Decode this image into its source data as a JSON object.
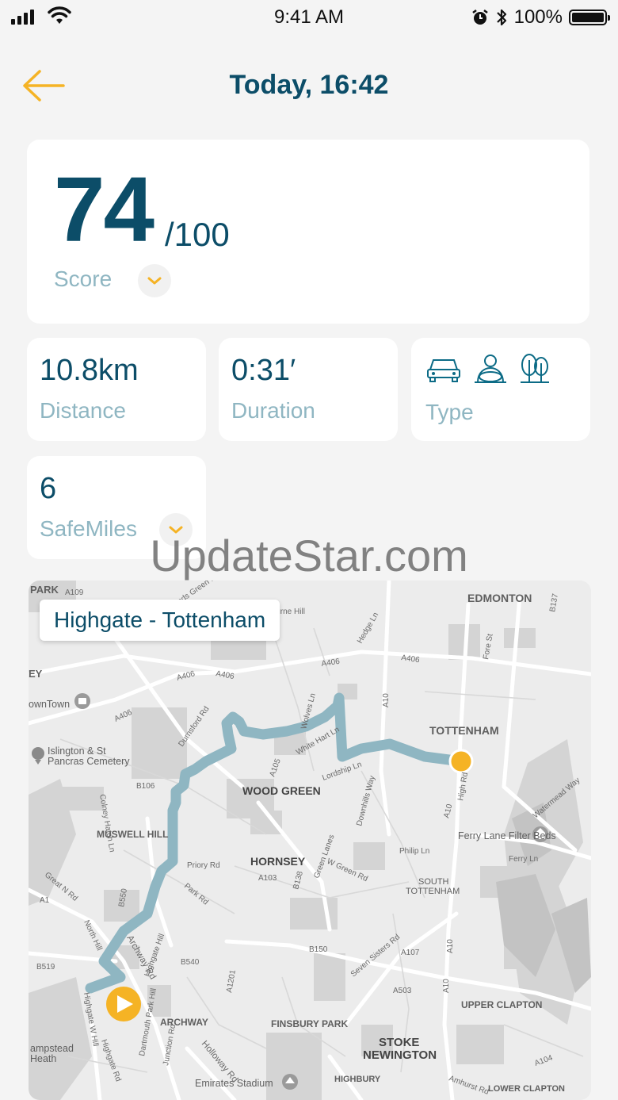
{
  "status_bar": {
    "time": "9:41 AM",
    "battery": "100%"
  },
  "header": {
    "title": "Today, 16:42"
  },
  "score": {
    "value": "74",
    "max": "/100",
    "label": "Score"
  },
  "stats": {
    "distance": {
      "value": "10.8km",
      "label": "Distance"
    },
    "duration": {
      "value": "0:31′",
      "label": "Duration"
    },
    "type": {
      "label": "Type",
      "icons": [
        "car-icon",
        "driver-icon",
        "trees-icon"
      ]
    },
    "safemiles": {
      "value": "6",
      "label": "SafeMiles"
    }
  },
  "watermark": "UpdateStar.com",
  "map": {
    "route_label": "Highgate - Tottenham",
    "labels": {
      "park": "PARK",
      "edmonton": "EDMONTON",
      "tottenham": "TOTTENHAM",
      "ey": "EY",
      "owntown": "ownTown",
      "islington": "Islington & St",
      "pancras": "Pancras Cemetery",
      "wood_green": "WOOD GREEN",
      "muswell_hill": "MUSWELL HILL",
      "hornsey": "HORNSEY",
      "ferry_lane": "Ferry Lane Filter Beds",
      "south": "SOUTH",
      "south_tottenham": "TOTTENHAM",
      "archway": "ARCHWAY",
      "finsbury_park": "FINSBURY PARK",
      "upper_clapton": "UPPER CLAPTON",
      "stoke": "STOKE",
      "newington": "NEWINGTON",
      "ampstead": "ampstead",
      "heath": "Heath",
      "emirates": "Emirates Stadium",
      "highbury": "HIGHBURY",
      "lower_clapton": "LOWER CLAPTON"
    },
    "roads": {
      "a406_1": "A406",
      "a406_2": "A406",
      "a406_3": "A406",
      "a406_4": "A406",
      "a406_5": "A406",
      "a10_1": "A10",
      "a10_2": "A10",
      "a10_3": "A10",
      "a10_4": "A10",
      "a1": "A1",
      "a107": "A107",
      "a103": "A103",
      "a105": "A105",
      "a104": "A104",
      "a503": "A503",
      "a1201": "A1201",
      "b150": "B150",
      "b540": "B540",
      "b550": "B550",
      "b519": "B519",
      "b106": "B106",
      "b138": "B138",
      "b137": "B137",
      "a109": "A109",
      "archway_rd": "Archway Rd",
      "holloway_rd": "Holloway Rd",
      "seven_sisters": "Seven Sisters Rd",
      "green_lanes": "Green Lanes",
      "high_rd": "High Rd",
      "fore_st": "Fore St",
      "hedge_ln": "Hedge Ln",
      "white_hart": "White Hart Ln",
      "lordship": "Lordship Ln",
      "priory": "Priory Rd",
      "park_rd": "Park Rd",
      "w_green": "W Green Rd",
      "philip": "Philip Ln",
      "ferry_ln": "Ferry Ln",
      "north_hill": "North Hill",
      "durnsford": "Durnsford Rd",
      "colney": "Colney Hatch Ln",
      "great_n": "Great N Rd",
      "wolves": "Wolves Ln",
      "hornsey_ln": "Highgate Hill",
      "highgate_w": "Highgate W Hill",
      "highgate_rd": "Highgate Rd",
      "dartmouth": "Dartmouth Park Hill",
      "junction": "Junction Rd",
      "amhurst": "Amhurst Rd",
      "watermead": "Watermead Way",
      "downhills": "Downhills Way",
      "rome_hill": "Bourne Hill",
      "bounds": "Bounds Green Rd"
    }
  }
}
